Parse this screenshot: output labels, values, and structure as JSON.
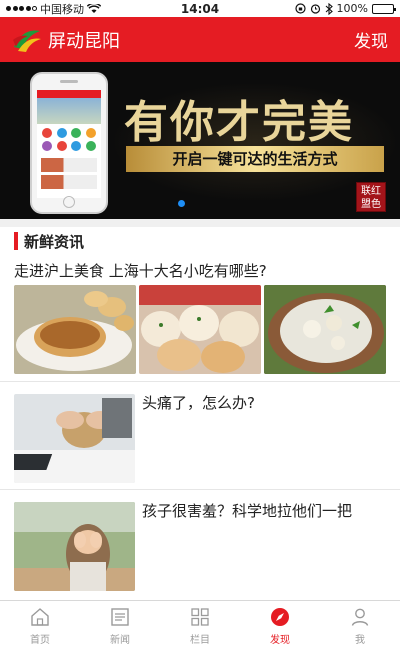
{
  "status_bar": {
    "carrier": "中国移动",
    "time": "14:04",
    "battery": "100%"
  },
  "header": {
    "title": "屏动昆阳",
    "action": "发现"
  },
  "banner": {
    "headline": "有你才完美",
    "subline": "开启一键可达的生活方式",
    "seal": "联红盟色",
    "active_slide": 1,
    "slide_count": 1
  },
  "section": {
    "title": "新鲜资讯"
  },
  "articles": [
    {
      "title": "走进沪上美食 上海十大名小吃有哪些?"
    },
    {
      "title": "头痛了，怎么办?"
    },
    {
      "title": "孩子很害羞？科学地拉他们一把"
    }
  ],
  "tabbar": {
    "items": [
      {
        "label": "首页",
        "icon": "home-icon"
      },
      {
        "label": "新闻",
        "icon": "news-icon"
      },
      {
        "label": "栏目",
        "icon": "grid-icon"
      },
      {
        "label": "发现",
        "icon": "compass-icon"
      },
      {
        "label": "我",
        "icon": "person-icon"
      }
    ],
    "active": "发现"
  },
  "colors": {
    "brand": "#e51c23",
    "pager": "#1e8ef5",
    "inactive_tab": "#9a9a9a"
  }
}
